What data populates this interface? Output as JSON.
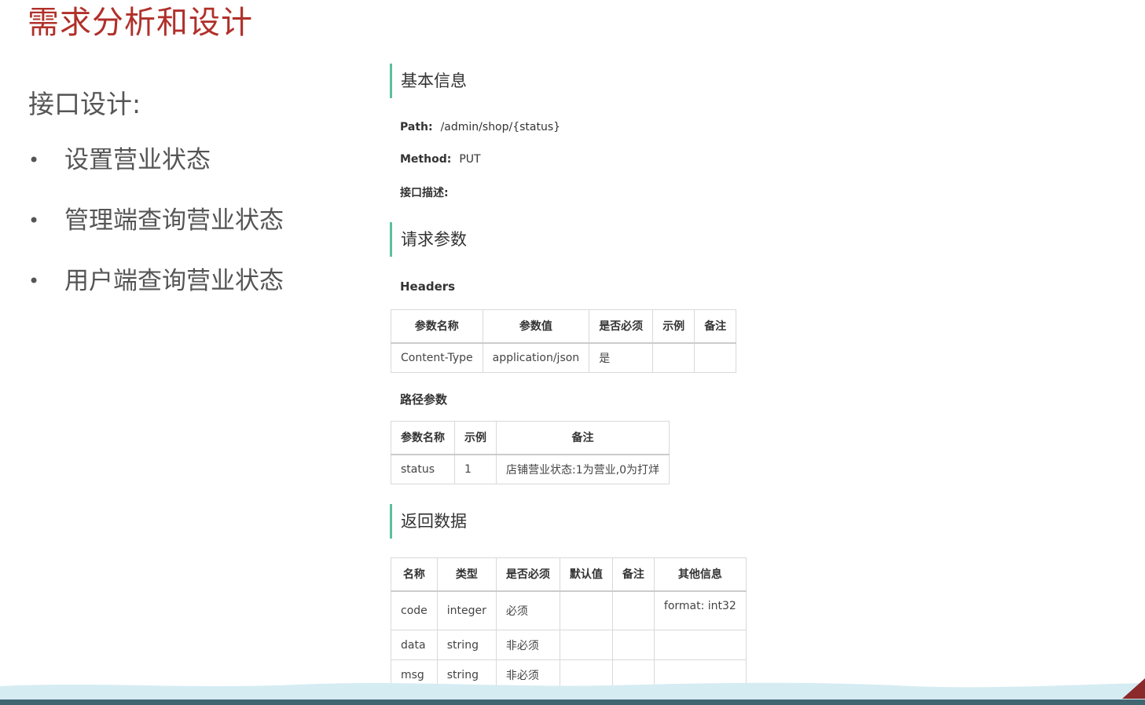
{
  "page_title": "需求分析和设计",
  "left": {
    "heading": "接口设计:",
    "bullet_symbol": "•",
    "items": [
      "设置营业状态",
      "管理端查询营业状态",
      "用户端查询营业状态"
    ]
  },
  "api": {
    "basic_info_heading": "基本信息",
    "path_label": "Path:",
    "path_value": "/admin/shop/{status}",
    "method_label": "Method:",
    "method_value": "PUT",
    "desc_label": "接口描述:",
    "request_heading": "请求参数",
    "headers_label": "Headers",
    "headers_table": {
      "columns": [
        "参数名称",
        "参数值",
        "是否必须",
        "示例",
        "备注"
      ],
      "rows": [
        [
          "Content-Type",
          "application/json",
          "是",
          "",
          ""
        ]
      ]
    },
    "path_params_label": "路径参数",
    "path_params_table": {
      "columns": [
        "参数名称",
        "示例",
        "备注"
      ],
      "rows": [
        [
          "status",
          "1",
          "店铺营业状态:1为营业,0为打烊"
        ]
      ]
    },
    "response_heading": "返回数据",
    "response_table": {
      "columns": [
        "名称",
        "类型",
        "是否必须",
        "默认值",
        "备注",
        "其他信息"
      ],
      "rows": [
        [
          "code",
          "integer",
          "必须",
          "",
          "",
          "format: int32"
        ],
        [
          "data",
          "string",
          "非必须",
          "",
          "",
          ""
        ],
        [
          "msg",
          "string",
          "非必须",
          "",
          "",
          ""
        ]
      ]
    }
  },
  "colors": {
    "title": "#b0302a",
    "section_bar": "#5dbf9a",
    "wave": "#d6ecf3",
    "footer_band": "#3f6671",
    "corner": "#8a2a2a"
  }
}
